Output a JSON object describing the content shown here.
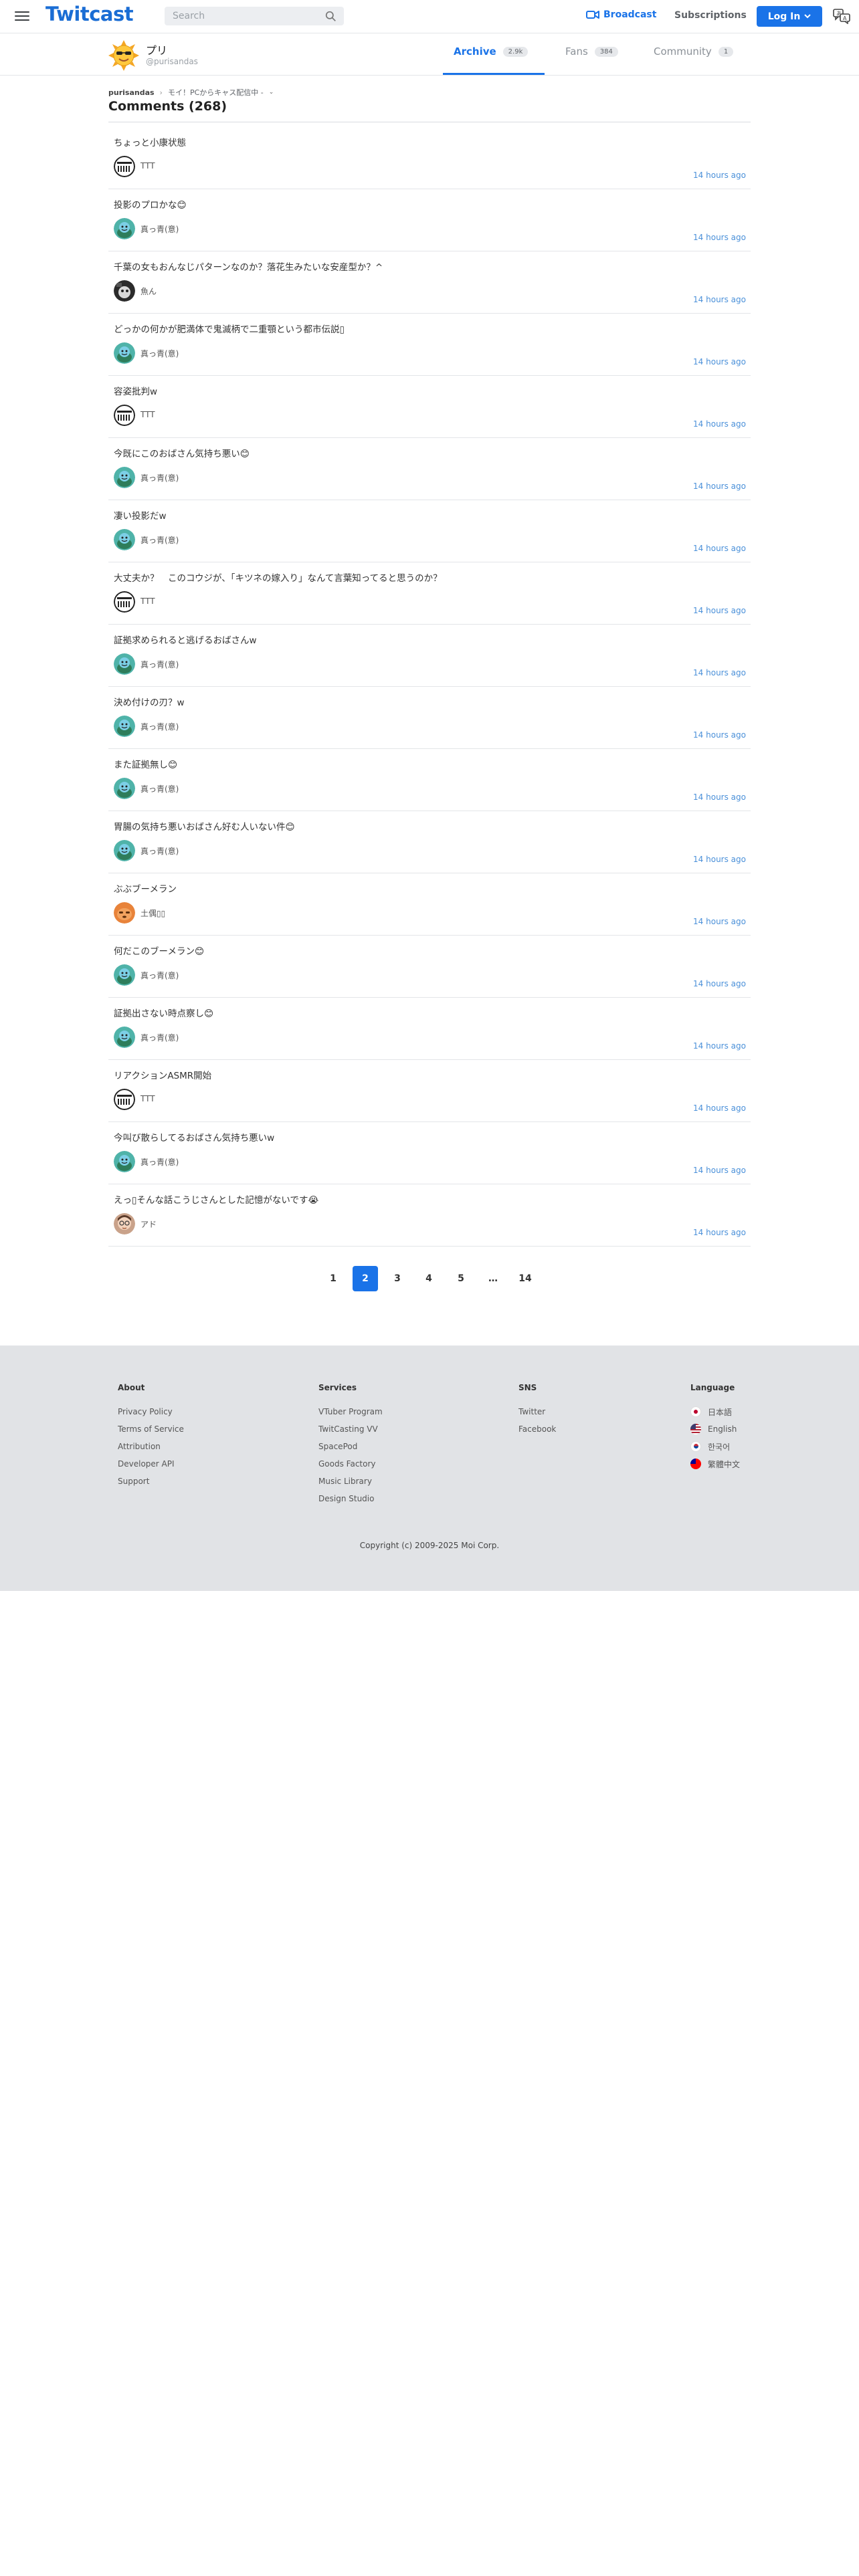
{
  "header": {
    "logo": "Twitcast",
    "search_placeholder": "Search",
    "broadcast_label": "Broadcast",
    "subscriptions_label": "Subscriptions",
    "login_label": "Log In",
    "brand_color": "#1a73e8"
  },
  "profile": {
    "name": "プリ",
    "id": "@purisandas",
    "tabs": [
      {
        "label": "Archive",
        "count": "2.9k"
      },
      {
        "label": "Fans",
        "count": "384"
      },
      {
        "label": "Community",
        "count": "1"
      }
    ],
    "active_tab": "Archive"
  },
  "breadcrumb": {
    "user": "purisandas",
    "separator": "›",
    "movie": "モイ！PCからキャス配信中 -"
  },
  "comments_title": "Comments (268)",
  "comments": [
    {
      "text": "ちょっと小康状態",
      "user": "TTT",
      "time": "14 hours ago",
      "avatar": "ttt"
    },
    {
      "text": "投影のプロかな😊",
      "user": "真っ青(意)",
      "time": "14 hours ago",
      "avatar": "blue"
    },
    {
      "text": "千葉の女もおんなじパターンなのか？落花生みたいな安産型か？^",
      "user": "魚ん",
      "time": "14 hours ago",
      "avatar": "fish"
    },
    {
      "text": "どっかの何かが肥満体で鬼滅柄で二重顎という都市伝説▯",
      "user": "真っ青(意)",
      "time": "14 hours ago",
      "avatar": "blue"
    },
    {
      "text": "容姿批判w",
      "user": "TTT",
      "time": "14 hours ago",
      "avatar": "ttt"
    },
    {
      "text": "今既にこのおばさん気持ち悪い😊",
      "user": "真っ青(意)",
      "time": "14 hours ago",
      "avatar": "blue"
    },
    {
      "text": "凄い投影だw",
      "user": "真っ青(意)",
      "time": "14 hours ago",
      "avatar": "blue"
    },
    {
      "text": "大丈夫か？　このコウジが、「キツネの嫁入り」なんて言葉知ってると思うのか？",
      "user": "TTT",
      "time": "14 hours ago",
      "avatar": "ttt"
    },
    {
      "text": "証拠求められると逃げるおばさんw",
      "user": "真っ青(意)",
      "time": "14 hours ago",
      "avatar": "blue"
    },
    {
      "text": "決め付けの刃？w",
      "user": "真っ青(意)",
      "time": "14 hours ago",
      "avatar": "blue"
    },
    {
      "text": "また証拠無し😊",
      "user": "真っ青(意)",
      "time": "14 hours ago",
      "avatar": "blue"
    },
    {
      "text": "胃腸の気持ち悪いおばさん好む人いない件😊",
      "user": "真っ青(意)",
      "time": "14 hours ago",
      "avatar": "blue"
    },
    {
      "text": "ぶぶブーメラン",
      "user": "土偶▯▯",
      "time": "14 hours ago",
      "avatar": "dogu"
    },
    {
      "text": "何だこのブーメラン😊",
      "user": "真っ青(意)",
      "time": "14 hours ago",
      "avatar": "blue"
    },
    {
      "text": "証拠出さない時点察し😊",
      "user": "真っ青(意)",
      "time": "14 hours ago",
      "avatar": "blue"
    },
    {
      "text": "リアクションASMR開始",
      "user": "TTT",
      "time": "14 hours ago",
      "avatar": "ttt"
    },
    {
      "text": "今叫び散らしてるおばさん気持ち悪いw",
      "user": "真っ青(意)",
      "time": "14 hours ago",
      "avatar": "blue"
    },
    {
      "text": "えっ▯そんな話こうじさんとした記憶がないです😭",
      "user": "アド",
      "time": "14 hours ago",
      "avatar": "ado"
    }
  ],
  "pagination": {
    "pages": [
      "1",
      "2",
      "3",
      "4",
      "5",
      "…",
      "14"
    ],
    "active": "2"
  },
  "footer": {
    "about": {
      "heading": "About",
      "links": [
        "Privacy Policy",
        "Terms of Service",
        "Attribution",
        "Developer API",
        "Support"
      ]
    },
    "services": {
      "heading": "Services",
      "links": [
        "VTuber Program",
        "TwitCasting VV",
        "SpacePod",
        "Goods Factory",
        "Music Library",
        "Design Studio"
      ]
    },
    "sns": {
      "heading": "SNS",
      "links": [
        "Twitter",
        "Facebook"
      ]
    },
    "language": {
      "heading": "Language",
      "items": [
        {
          "label": "日本語",
          "flag": "jp"
        },
        {
          "label": "English",
          "flag": "us"
        },
        {
          "label": "한국어",
          "flag": "kr"
        },
        {
          "label": "繁體中文",
          "flag": "tw"
        }
      ]
    },
    "copyright": "Copyright (c) 2009-2025 Moi Corp."
  }
}
